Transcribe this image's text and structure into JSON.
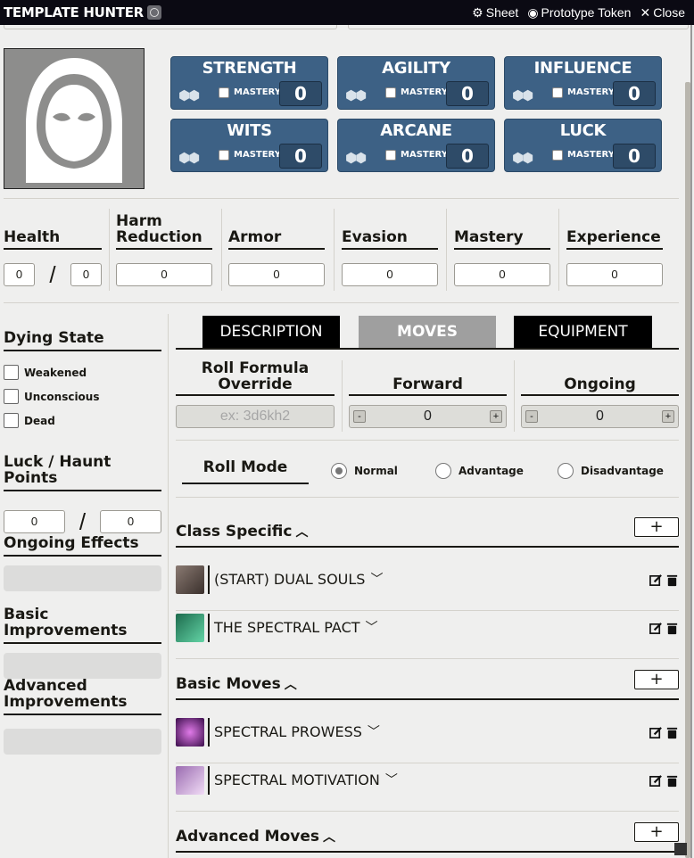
{
  "header": {
    "title": "TEMPLATE HUNTER",
    "sheet_label": "Sheet",
    "token_label": "Prototype Token",
    "close_label": "Close"
  },
  "stats": [
    {
      "name": "STRENGTH",
      "mastery_label": "MASTERY",
      "value": "0"
    },
    {
      "name": "AGILITY",
      "mastery_label": "MASTERY",
      "value": "0"
    },
    {
      "name": "INFLUENCE",
      "mastery_label": "MASTERY",
      "value": "0"
    },
    {
      "name": "WITS",
      "mastery_label": "MASTERY",
      "value": "0"
    },
    {
      "name": "ARCANE",
      "mastery_label": "MASTERY",
      "value": "0"
    },
    {
      "name": "LUCK",
      "mastery_label": "MASTERY",
      "value": "0"
    }
  ],
  "resources": {
    "health": {
      "label": "Health",
      "current": "0",
      "max": "0",
      "separator": "/"
    },
    "harm_reduction": {
      "label": "Harm Reduction",
      "value": "0"
    },
    "armor": {
      "label": "Armor",
      "value": "0"
    },
    "evasion": {
      "label": "Evasion",
      "value": "0"
    },
    "mastery": {
      "label": "Mastery",
      "value": "0"
    },
    "experience": {
      "label": "Experience",
      "value": "0"
    }
  },
  "sidebar": {
    "dying_state": {
      "title": "Dying State",
      "options": [
        "Weakened",
        "Unconscious",
        "Dead"
      ]
    },
    "luck_haunt": {
      "title": "Luck / Haunt Points",
      "current": "0",
      "max": "0",
      "separator": "/"
    },
    "ongoing_effects": {
      "title": "Ongoing Effects"
    },
    "basic_improvements": {
      "title": "Basic Improvements"
    },
    "advanced_improvements": {
      "title": "Advanced Improvements"
    }
  },
  "tabs": [
    {
      "label": "DESCRIPTION",
      "active": false
    },
    {
      "label": "MOVES",
      "active": true
    },
    {
      "label": "EQUIPMENT",
      "active": false
    }
  ],
  "roll": {
    "formula_label": "Roll Formula Override",
    "formula_placeholder": "ex: 3d6kh2",
    "forward_label": "Forward",
    "forward_value": "0",
    "ongoing_label": "Ongoing",
    "ongoing_value": "0",
    "minus": "-",
    "plus": "+",
    "mode_label": "Roll Mode",
    "modes": [
      {
        "label": "Normal",
        "selected": true
      },
      {
        "label": "Advantage",
        "selected": false
      },
      {
        "label": "Disadvantage",
        "selected": false
      }
    ]
  },
  "move_sections": [
    {
      "title": "Class Specific",
      "add_label": "+",
      "moves": [
        {
          "name": "(START) DUAL SOULS",
          "thumb_color": "#6b5a55"
        },
        {
          "name": "THE SPECTRAL PACT",
          "thumb_color": "#2f8f6a"
        }
      ]
    },
    {
      "title": "Basic Moves",
      "add_label": "+",
      "moves": [
        {
          "name": "SPECTRAL PROWESS",
          "thumb_color": "#7b2d8c"
        },
        {
          "name": "SPECTRAL MOTIVATION",
          "thumb_color": "#c9a3d9"
        }
      ]
    },
    {
      "title": "Advanced Moves",
      "add_label": "+",
      "moves": []
    }
  ],
  "colors": {
    "stat_bg": "#3d6185",
    "stat_value_bg": "#2e4b68",
    "titlebar_bg": "#0b0a13",
    "tab_active_bg": "#9f9f9f",
    "tab_bg": "#000000",
    "page_bg": "#efefee"
  }
}
